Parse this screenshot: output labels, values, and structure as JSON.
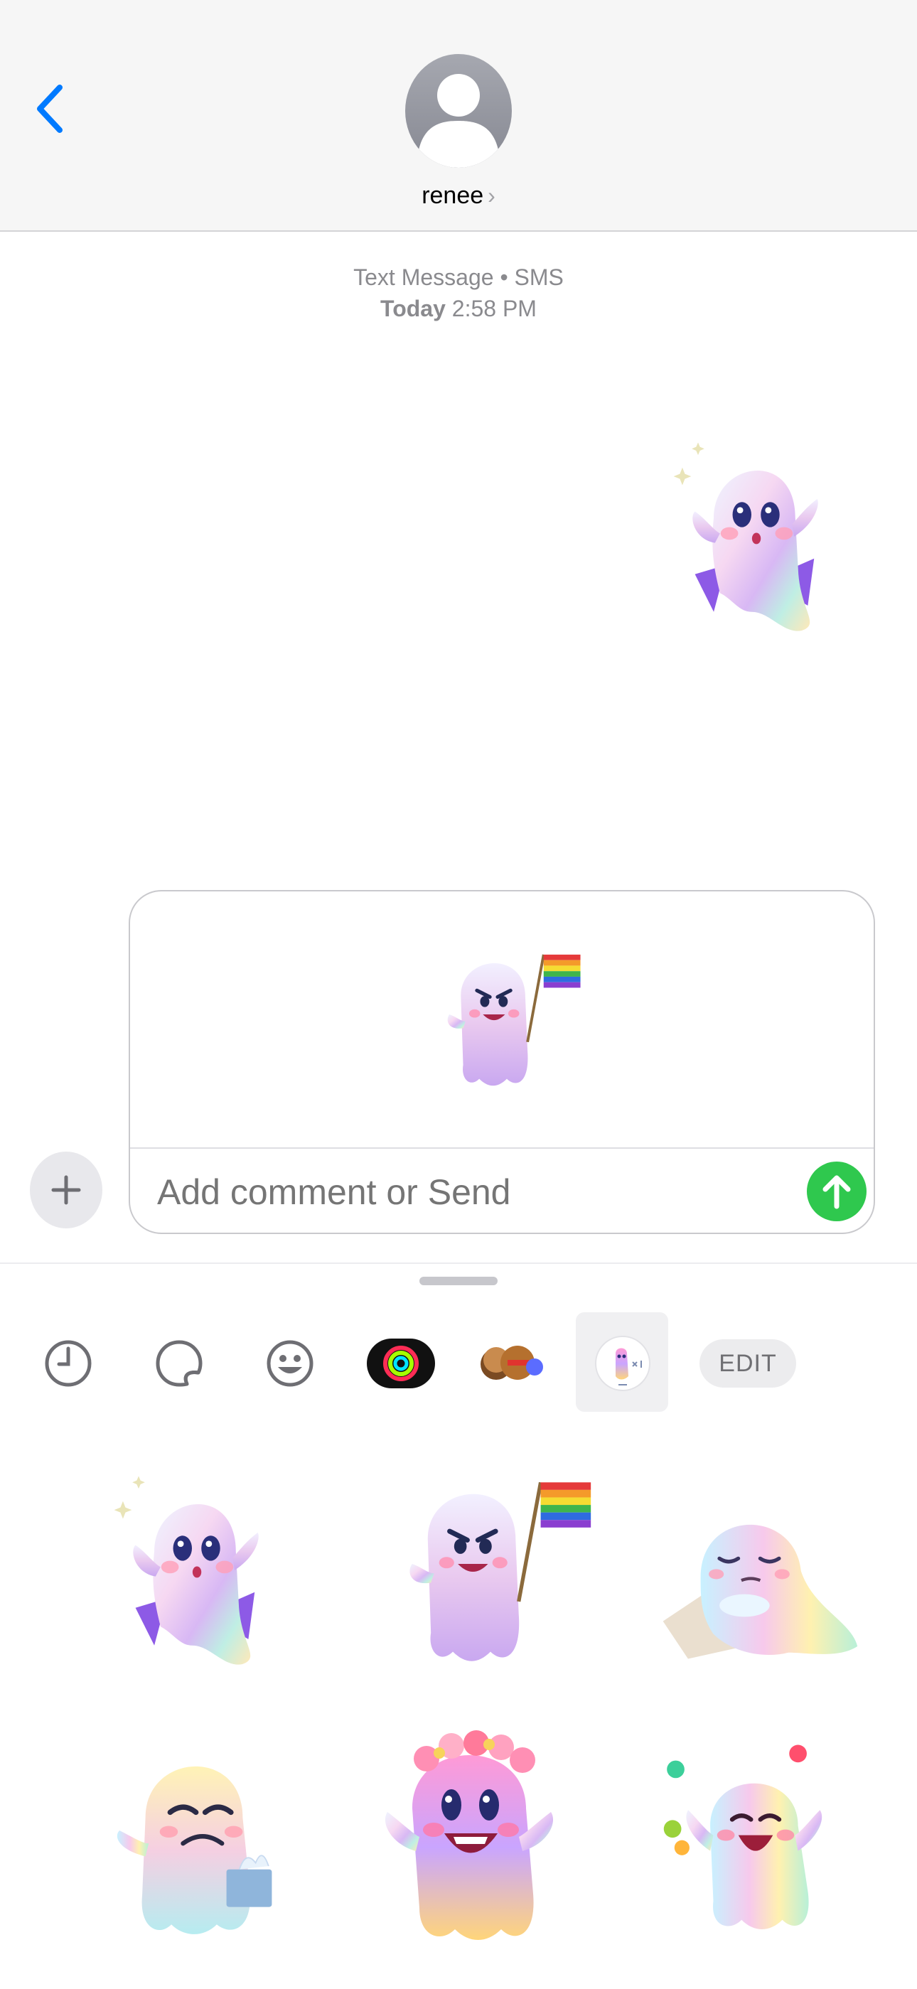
{
  "header": {
    "contact_name": "renee",
    "contact_chevron": "›",
    "back_icon": "chevron-left-icon",
    "avatar_icon": "person-silhouette-icon"
  },
  "conversation": {
    "service_label": "Text Message • SMS",
    "day_label": "Today",
    "time_label": "2:58 PM",
    "sent_sticker": "ghost-cape-surprised-sticker"
  },
  "compose": {
    "attached_sticker": "ghost-pride-flag-sticker",
    "placeholder": "Add comment or Send",
    "send_icon": "arrow-up-icon",
    "plus_icon": "plus-icon"
  },
  "sticker_drawer": {
    "tabs": [
      {
        "name": "recents",
        "icon": "clock-icon"
      },
      {
        "name": "stickers",
        "icon": "sticker-peel-icon"
      },
      {
        "name": "emoji",
        "icon": "smiley-icon"
      },
      {
        "name": "activity",
        "icon": "activity-rings-icon"
      },
      {
        "name": "memoji",
        "icon": "memoji-icon"
      },
      {
        "name": "ghost-pack",
        "icon": "ghost-pack-icon",
        "selected": true
      }
    ],
    "edit_label": "EDIT",
    "stickers": [
      "ghost-cape-surprised",
      "ghost-pride-flag",
      "ghost-sleepy-pillow",
      "ghost-sad-tissues",
      "ghost-flower-crown",
      "ghost-juggling"
    ]
  },
  "colors": {
    "accent_blue": "#007aff",
    "send_green": "#2fc84e",
    "header_bg": "#f6f6f6",
    "secondary_text": "#8a8a8e"
  }
}
